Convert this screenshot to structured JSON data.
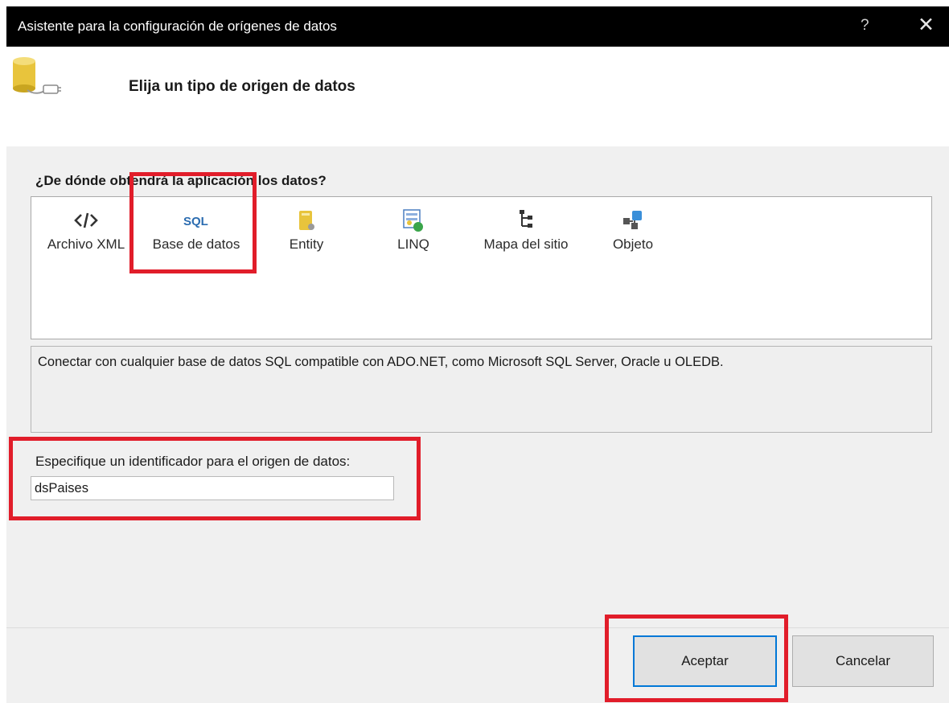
{
  "window": {
    "title": "Asistente para la configuración de orígenes de datos",
    "help_label": "?",
    "close_label": "✕"
  },
  "header": {
    "icon": "database-connection-icon",
    "title": "Elija un tipo de origen de datos"
  },
  "source_type": {
    "question": "¿De dónde obtendrá la aplicación los datos?",
    "selected": "Base de datos",
    "items": [
      {
        "label": "Archivo XML",
        "icon": "xml-icon"
      },
      {
        "label": "Base de datos",
        "icon": "sql-database-icon"
      },
      {
        "label": "Entity",
        "icon": "entity-icon"
      },
      {
        "label": "LINQ",
        "icon": "linq-icon"
      },
      {
        "label": "Mapa del sitio",
        "icon": "sitemap-icon"
      },
      {
        "label": "Objeto",
        "icon": "object-icon"
      }
    ],
    "description": "Conectar con cualquier base de datos SQL compatible con ADO.NET, como Microsoft SQL Server, Oracle u OLEDB."
  },
  "identifier": {
    "label": "Especifique un identificador para el origen de datos:",
    "value": "dsPaises"
  },
  "buttons": {
    "accept_label": "Aceptar",
    "cancel_label": "Cancelar"
  },
  "colors": {
    "titlebar": "#000000",
    "highlight": "#e11d2a",
    "focus": "#0078d7",
    "dialog_bg": "#f0f0f0"
  }
}
